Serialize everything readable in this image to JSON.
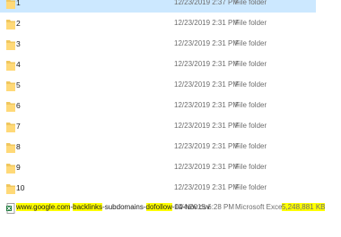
{
  "highlight_color": "#ffff00",
  "selection_color": "#cce8ff",
  "folders": [
    {
      "name": "1",
      "date": "12/23/2019 2:37 PM",
      "type": "File folder",
      "selected": true
    },
    {
      "name": "2",
      "date": "12/23/2019 2:31 PM",
      "type": "File folder"
    },
    {
      "name": "3",
      "date": "12/23/2019 2:31 PM",
      "type": "File folder"
    },
    {
      "name": "4",
      "date": "12/23/2019 2:31 PM",
      "type": "File folder"
    },
    {
      "name": "5",
      "date": "12/23/2019 2:31 PM",
      "type": "File folder"
    },
    {
      "name": "6",
      "date": "12/23/2019 2:31 PM",
      "type": "File folder"
    },
    {
      "name": "7",
      "date": "12/23/2019 2:31 PM",
      "type": "File folder"
    },
    {
      "name": "8",
      "date": "12/23/2019 2:31 PM",
      "type": "File folder"
    },
    {
      "name": "9",
      "date": "12/23/2019 2:31 PM",
      "type": "File folder"
    },
    {
      "name": "10",
      "date": "12/23/2019 2:31 PM",
      "type": "File folder"
    }
  ],
  "csv_file": {
    "name_parts": [
      {
        "text": "www.google.com",
        "highlight": true
      },
      {
        "text": "-",
        "highlight": false
      },
      {
        "text": "backlinks",
        "highlight": true
      },
      {
        "text": "-subdomains-",
        "highlight": false
      },
      {
        "text": "dofollow",
        "highlight": true
      },
      {
        "text": "-04-Nov.csv",
        "highlight": false
      }
    ],
    "date": "11/4/2015 6:28 PM",
    "type": "Microsoft Excel C...",
    "size": "5,248,881 KB",
    "size_highlight": true,
    "icon": "excel-csv-icon"
  },
  "folder_icon": "folder-icon"
}
